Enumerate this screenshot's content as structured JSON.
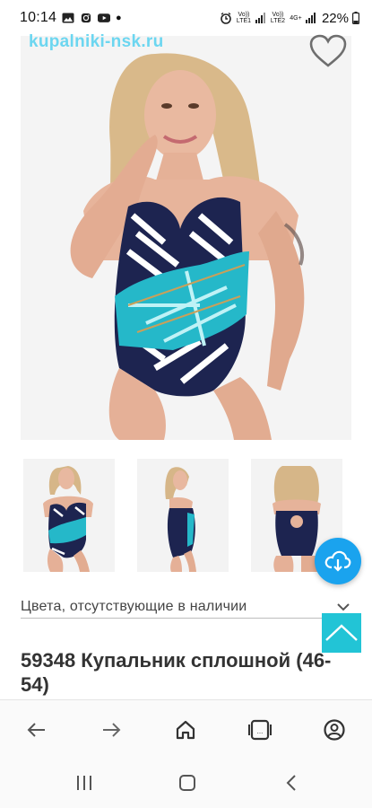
{
  "status_bar": {
    "time": "10:14",
    "battery": "22%",
    "sim1": "Vo)) LTE1",
    "sim2": "Vo)) LTE2",
    "net": "4G+"
  },
  "product": {
    "watermark": "kupalniki-nsk.ru",
    "title": "59348 Купальник сплошной (46-54)",
    "colors_label": "Цвета, отсутствующие в наличии"
  },
  "colors": {
    "accent_fab": "#1aa3ee",
    "scroll_top": "#22c4d6",
    "watermark": "#5ed3f0"
  },
  "icons": {
    "heart": "heart-icon",
    "cloud": "cloud-download-icon",
    "chevron": "chevron-down-icon",
    "scroll": "chevron-up-icon"
  }
}
